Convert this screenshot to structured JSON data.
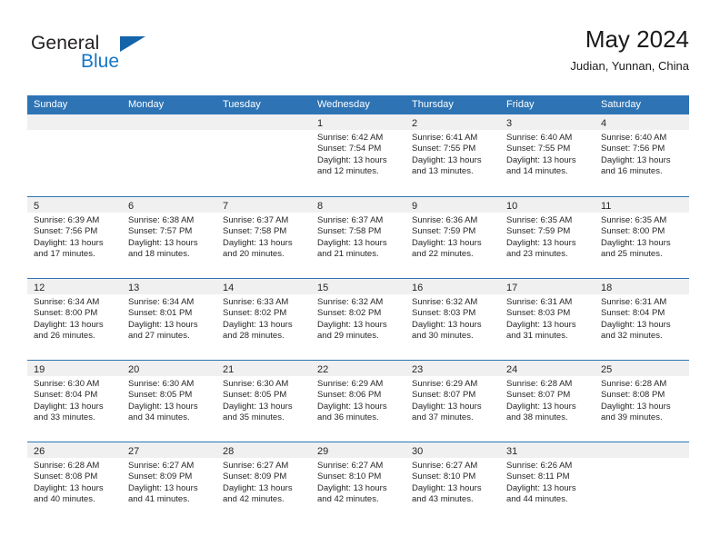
{
  "brand": {
    "name_part1": "General",
    "name_part2": "Blue",
    "triangle_icon": "triangle-logo-icon",
    "accent_color": "#1476c6"
  },
  "header": {
    "title": "May 2024",
    "subtitle": "Judian, Yunnan, China"
  },
  "theme": {
    "header_blue": "#2e74b5",
    "date_strip_gray": "#f0f0f0",
    "text_color": "#262626"
  },
  "weekdays": [
    "Sunday",
    "Monday",
    "Tuesday",
    "Wednesday",
    "Thursday",
    "Friday",
    "Saturday"
  ],
  "weeks": [
    [
      {
        "day": "",
        "sunrise": "",
        "sunset": "",
        "daylight1": "",
        "daylight2": ""
      },
      {
        "day": "",
        "sunrise": "",
        "sunset": "",
        "daylight1": "",
        "daylight2": ""
      },
      {
        "day": "",
        "sunrise": "",
        "sunset": "",
        "daylight1": "",
        "daylight2": ""
      },
      {
        "day": "1",
        "sunrise": "Sunrise: 6:42 AM",
        "sunset": "Sunset: 7:54 PM",
        "daylight1": "Daylight: 13 hours",
        "daylight2": "and 12 minutes."
      },
      {
        "day": "2",
        "sunrise": "Sunrise: 6:41 AM",
        "sunset": "Sunset: 7:55 PM",
        "daylight1": "Daylight: 13 hours",
        "daylight2": "and 13 minutes."
      },
      {
        "day": "3",
        "sunrise": "Sunrise: 6:40 AM",
        "sunset": "Sunset: 7:55 PM",
        "daylight1": "Daylight: 13 hours",
        "daylight2": "and 14 minutes."
      },
      {
        "day": "4",
        "sunrise": "Sunrise: 6:40 AM",
        "sunset": "Sunset: 7:56 PM",
        "daylight1": "Daylight: 13 hours",
        "daylight2": "and 16 minutes."
      }
    ],
    [
      {
        "day": "5",
        "sunrise": "Sunrise: 6:39 AM",
        "sunset": "Sunset: 7:56 PM",
        "daylight1": "Daylight: 13 hours",
        "daylight2": "and 17 minutes."
      },
      {
        "day": "6",
        "sunrise": "Sunrise: 6:38 AM",
        "sunset": "Sunset: 7:57 PM",
        "daylight1": "Daylight: 13 hours",
        "daylight2": "and 18 minutes."
      },
      {
        "day": "7",
        "sunrise": "Sunrise: 6:37 AM",
        "sunset": "Sunset: 7:58 PM",
        "daylight1": "Daylight: 13 hours",
        "daylight2": "and 20 minutes."
      },
      {
        "day": "8",
        "sunrise": "Sunrise: 6:37 AM",
        "sunset": "Sunset: 7:58 PM",
        "daylight1": "Daylight: 13 hours",
        "daylight2": "and 21 minutes."
      },
      {
        "day": "9",
        "sunrise": "Sunrise: 6:36 AM",
        "sunset": "Sunset: 7:59 PM",
        "daylight1": "Daylight: 13 hours",
        "daylight2": "and 22 minutes."
      },
      {
        "day": "10",
        "sunrise": "Sunrise: 6:35 AM",
        "sunset": "Sunset: 7:59 PM",
        "daylight1": "Daylight: 13 hours",
        "daylight2": "and 23 minutes."
      },
      {
        "day": "11",
        "sunrise": "Sunrise: 6:35 AM",
        "sunset": "Sunset: 8:00 PM",
        "daylight1": "Daylight: 13 hours",
        "daylight2": "and 25 minutes."
      }
    ],
    [
      {
        "day": "12",
        "sunrise": "Sunrise: 6:34 AM",
        "sunset": "Sunset: 8:00 PM",
        "daylight1": "Daylight: 13 hours",
        "daylight2": "and 26 minutes."
      },
      {
        "day": "13",
        "sunrise": "Sunrise: 6:34 AM",
        "sunset": "Sunset: 8:01 PM",
        "daylight1": "Daylight: 13 hours",
        "daylight2": "and 27 minutes."
      },
      {
        "day": "14",
        "sunrise": "Sunrise: 6:33 AM",
        "sunset": "Sunset: 8:02 PM",
        "daylight1": "Daylight: 13 hours",
        "daylight2": "and 28 minutes."
      },
      {
        "day": "15",
        "sunrise": "Sunrise: 6:32 AM",
        "sunset": "Sunset: 8:02 PM",
        "daylight1": "Daylight: 13 hours",
        "daylight2": "and 29 minutes."
      },
      {
        "day": "16",
        "sunrise": "Sunrise: 6:32 AM",
        "sunset": "Sunset: 8:03 PM",
        "daylight1": "Daylight: 13 hours",
        "daylight2": "and 30 minutes."
      },
      {
        "day": "17",
        "sunrise": "Sunrise: 6:31 AM",
        "sunset": "Sunset: 8:03 PM",
        "daylight1": "Daylight: 13 hours",
        "daylight2": "and 31 minutes."
      },
      {
        "day": "18",
        "sunrise": "Sunrise: 6:31 AM",
        "sunset": "Sunset: 8:04 PM",
        "daylight1": "Daylight: 13 hours",
        "daylight2": "and 32 minutes."
      }
    ],
    [
      {
        "day": "19",
        "sunrise": "Sunrise: 6:30 AM",
        "sunset": "Sunset: 8:04 PM",
        "daylight1": "Daylight: 13 hours",
        "daylight2": "and 33 minutes."
      },
      {
        "day": "20",
        "sunrise": "Sunrise: 6:30 AM",
        "sunset": "Sunset: 8:05 PM",
        "daylight1": "Daylight: 13 hours",
        "daylight2": "and 34 minutes."
      },
      {
        "day": "21",
        "sunrise": "Sunrise: 6:30 AM",
        "sunset": "Sunset: 8:05 PM",
        "daylight1": "Daylight: 13 hours",
        "daylight2": "and 35 minutes."
      },
      {
        "day": "22",
        "sunrise": "Sunrise: 6:29 AM",
        "sunset": "Sunset: 8:06 PM",
        "daylight1": "Daylight: 13 hours",
        "daylight2": "and 36 minutes."
      },
      {
        "day": "23",
        "sunrise": "Sunrise: 6:29 AM",
        "sunset": "Sunset: 8:07 PM",
        "daylight1": "Daylight: 13 hours",
        "daylight2": "and 37 minutes."
      },
      {
        "day": "24",
        "sunrise": "Sunrise: 6:28 AM",
        "sunset": "Sunset: 8:07 PM",
        "daylight1": "Daylight: 13 hours",
        "daylight2": "and 38 minutes."
      },
      {
        "day": "25",
        "sunrise": "Sunrise: 6:28 AM",
        "sunset": "Sunset: 8:08 PM",
        "daylight1": "Daylight: 13 hours",
        "daylight2": "and 39 minutes."
      }
    ],
    [
      {
        "day": "26",
        "sunrise": "Sunrise: 6:28 AM",
        "sunset": "Sunset: 8:08 PM",
        "daylight1": "Daylight: 13 hours",
        "daylight2": "and 40 minutes."
      },
      {
        "day": "27",
        "sunrise": "Sunrise: 6:27 AM",
        "sunset": "Sunset: 8:09 PM",
        "daylight1": "Daylight: 13 hours",
        "daylight2": "and 41 minutes."
      },
      {
        "day": "28",
        "sunrise": "Sunrise: 6:27 AM",
        "sunset": "Sunset: 8:09 PM",
        "daylight1": "Daylight: 13 hours",
        "daylight2": "and 42 minutes."
      },
      {
        "day": "29",
        "sunrise": "Sunrise: 6:27 AM",
        "sunset": "Sunset: 8:10 PM",
        "daylight1": "Daylight: 13 hours",
        "daylight2": "and 42 minutes."
      },
      {
        "day": "30",
        "sunrise": "Sunrise: 6:27 AM",
        "sunset": "Sunset: 8:10 PM",
        "daylight1": "Daylight: 13 hours",
        "daylight2": "and 43 minutes."
      },
      {
        "day": "31",
        "sunrise": "Sunrise: 6:26 AM",
        "sunset": "Sunset: 8:11 PM",
        "daylight1": "Daylight: 13 hours",
        "daylight2": "and 44 minutes."
      },
      {
        "day": "",
        "sunrise": "",
        "sunset": "",
        "daylight1": "",
        "daylight2": ""
      }
    ]
  ]
}
